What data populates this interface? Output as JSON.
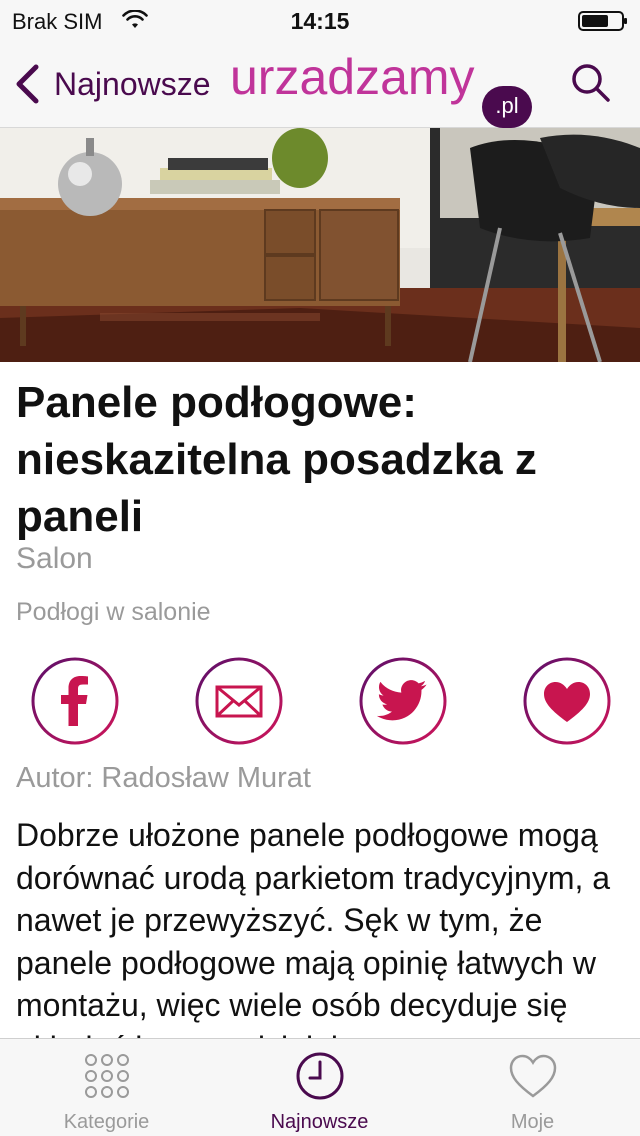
{
  "status_bar": {
    "carrier": "Brak SIM",
    "time": "14:15"
  },
  "nav": {
    "back_label": "Najnowsze",
    "logo_text": "urzadzamy",
    "logo_suffix": ".pl"
  },
  "article": {
    "title": "Panele podłogowe: nieskazitelna posadzka z paneli",
    "category": "Salon",
    "subcategory": "Podłogi w salonie",
    "author": "Autor: Radosław Murat",
    "body": "Dobrze ułożone panele podłogowe mogą dorównać urodą parkietom tradycyjnym, a nawet je przewyższyć. Sęk w tym, że panele podłogowe mają opinię łatwych w montażu, więc wiele osób decyduje się układać je samodzielnie."
  },
  "share_buttons": [
    {
      "icon": "facebook-icon"
    },
    {
      "icon": "mail-icon"
    },
    {
      "icon": "twitter-icon"
    },
    {
      "icon": "heart-icon"
    }
  ],
  "tabs": [
    {
      "label": "Kategorie",
      "icon": "grid-icon",
      "active": false
    },
    {
      "label": "Najnowsze",
      "icon": "clock-icon",
      "active": true
    },
    {
      "label": "Moje",
      "icon": "heart-outline-icon",
      "active": false
    }
  ],
  "colors": {
    "brand_dark": "#4a0a4e",
    "brand_pink": "#c0349a",
    "share_accent": "#c8154f",
    "muted_text": "#9a9a9a"
  }
}
